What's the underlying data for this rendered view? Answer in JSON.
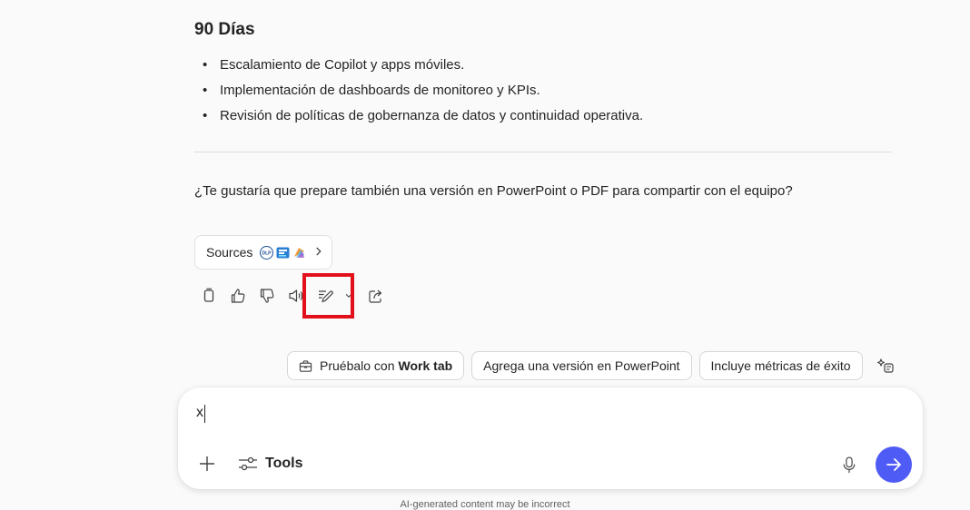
{
  "section": {
    "heading": "90 Días",
    "bullets": [
      "Escalamiento de Copilot y apps móviles.",
      "Implementación de dashboards de monitoreo y KPIs.",
      "Revisión de políticas de gobernanza de datos y continuidad operativa."
    ]
  },
  "question": "¿Te gustaría que prepare también una versión en PowerPoint o PDF para compartir con el equipo?",
  "sources": {
    "label": "Sources",
    "icons": [
      "dlp-source-icon",
      "bar-chart-source-icon",
      "colorful-source-icon"
    ]
  },
  "actions": [
    "copy-icon",
    "thumbs-up-icon",
    "thumbs-down-icon",
    "speaker-icon",
    "edit-pen-icon",
    "chevron-down-icon",
    "share-icon"
  ],
  "suggestions": {
    "chip1_prefix": "Pruébalo con",
    "chip1_bold": "Work tab",
    "chip2": "Agrega una versión en PowerPoint",
    "chip3": "Incluye métricas de éxito"
  },
  "composer": {
    "value": "x",
    "tools_label": "Tools"
  },
  "disclaimer": "AI-generated content may be incorrect",
  "colors": {
    "send_button": "#4f5bf5",
    "highlight": "#e2101b"
  }
}
